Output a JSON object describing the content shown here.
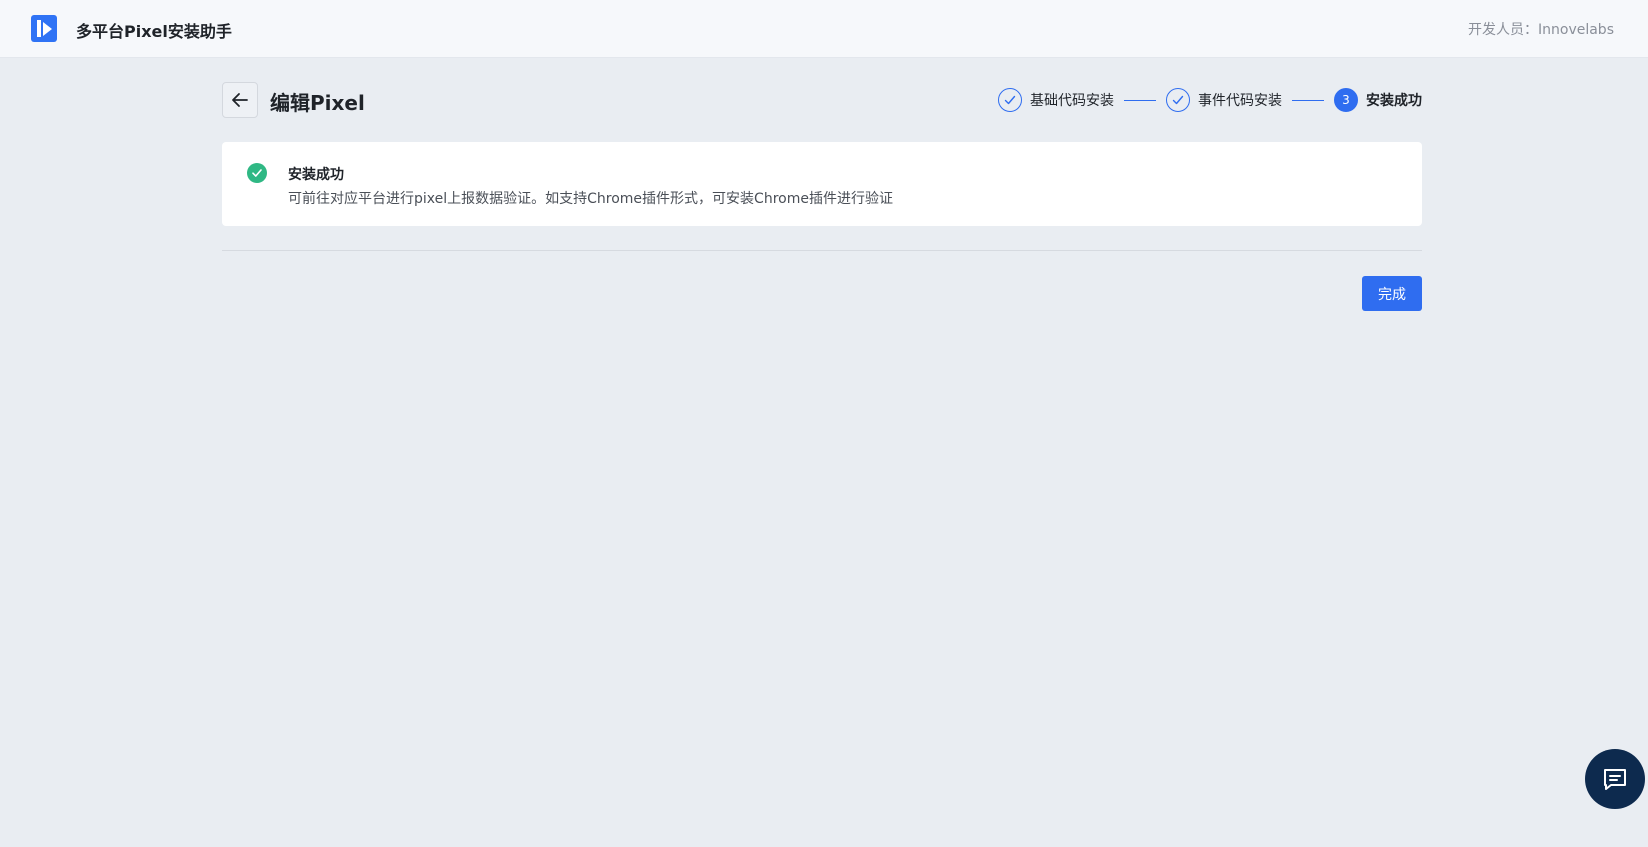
{
  "header": {
    "app_title": "多平台Pixel安装助手",
    "developer": "开发人员：Innovelabs"
  },
  "page": {
    "title": "编辑Pixel"
  },
  "steps": [
    {
      "index": "1",
      "label": "基础代码安装",
      "status": "done"
    },
    {
      "index": "2",
      "label": "事件代码安装",
      "status": "done"
    },
    {
      "index": "3",
      "label": "安装成功",
      "status": "active"
    }
  ],
  "result": {
    "title": "安装成功",
    "description": "可前往对应平台进行pixel上报数据验证。如支持Chrome插件形式，可安装Chrome插件进行验证"
  },
  "actions": {
    "done_label": "完成"
  },
  "colors": {
    "accent": "#2f6df0",
    "success": "#2fb884",
    "chat_bg": "#0d2a4e",
    "page_bg": "#e9edf2"
  }
}
